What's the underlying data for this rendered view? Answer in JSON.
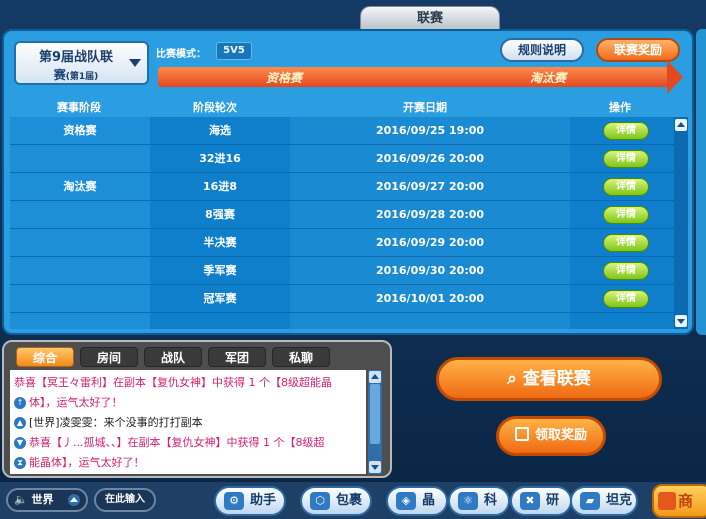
{
  "window": {
    "tab_title": "联赛"
  },
  "season": {
    "line1": "第9届战队联",
    "line2": "赛",
    "line2_sub": "(第1届)"
  },
  "mode": {
    "label": "比赛模式：",
    "value": "5V5"
  },
  "buttons": {
    "rules": "规则说明",
    "rewards": "联赛奖励",
    "view_league": "查看联赛",
    "claim_reward": "领取奖励"
  },
  "stages": {
    "qualifier": "资格赛",
    "knockout": "淘汰赛"
  },
  "table": {
    "headers": [
      "赛事阶段",
      "阶段轮次",
      "开赛日期",
      "操作"
    ],
    "rows": [
      {
        "stage": "资格赛",
        "round": "海选",
        "date": "2016/09/25 19:00",
        "action": "详情"
      },
      {
        "stage": "",
        "round": "32进16",
        "date": "2016/09/26 20:00",
        "action": "详情"
      },
      {
        "stage": "淘汰赛",
        "round": "16进8",
        "date": "2016/09/27 20:00",
        "action": "详情"
      },
      {
        "stage": "",
        "round": "8强赛",
        "date": "2016/09/28 20:00",
        "action": "详情"
      },
      {
        "stage": "",
        "round": "半决赛",
        "date": "2016/09/29 20:00",
        "action": "详情"
      },
      {
        "stage": "",
        "round": "季军赛",
        "date": "2016/09/30 20:00",
        "action": "详情"
      },
      {
        "stage": "",
        "round": "冠军赛",
        "date": "2016/10/01 20:00",
        "action": "详情"
      }
    ]
  },
  "chat": {
    "tabs": [
      "综合",
      "房间",
      "战队",
      "军团",
      "私聊"
    ],
    "active_tab": "综合",
    "lines": [
      {
        "icon": "",
        "text": "恭喜【冥王々雷利】在副本【复仇女神】中获得 1 个【8级超能晶",
        "color": "#d21f74"
      },
      {
        "icon": "↑",
        "text": "体】，运气太好了！",
        "color": "#d21f74"
      },
      {
        "icon": "▲",
        "text": "[世界]凌雯雯：来个没事的打打副本",
        "color": "#222222"
      },
      {
        "icon": "▼",
        "text": "恭喜【丿...孤城、、】在副本【复仇女神】中获得 1 个【8级超",
        "color": "#d21f74"
      },
      {
        "icon": "⧗",
        "text": "能晶体】，运气太好了！",
        "color": "#d21f74"
      }
    ]
  },
  "bottom": {
    "channel": "世界",
    "input_placeholder": "在此输入",
    "nav": [
      {
        "label": "助手",
        "icon": "assistant-icon"
      },
      {
        "label": "包裹",
        "icon": "package-icon"
      },
      {
        "label": "晶片",
        "icon": "chip-icon"
      },
      {
        "label": "科技",
        "icon": "tech-icon"
      },
      {
        "label": "研发",
        "icon": "research-icon"
      },
      {
        "label": "坦克",
        "icon": "tank-icon"
      }
    ],
    "shop": "商"
  },
  "colors": {
    "accent_orange": "#ef6a12",
    "panel_blue": "#2a9ee0",
    "detail_green": "#7fc517"
  }
}
